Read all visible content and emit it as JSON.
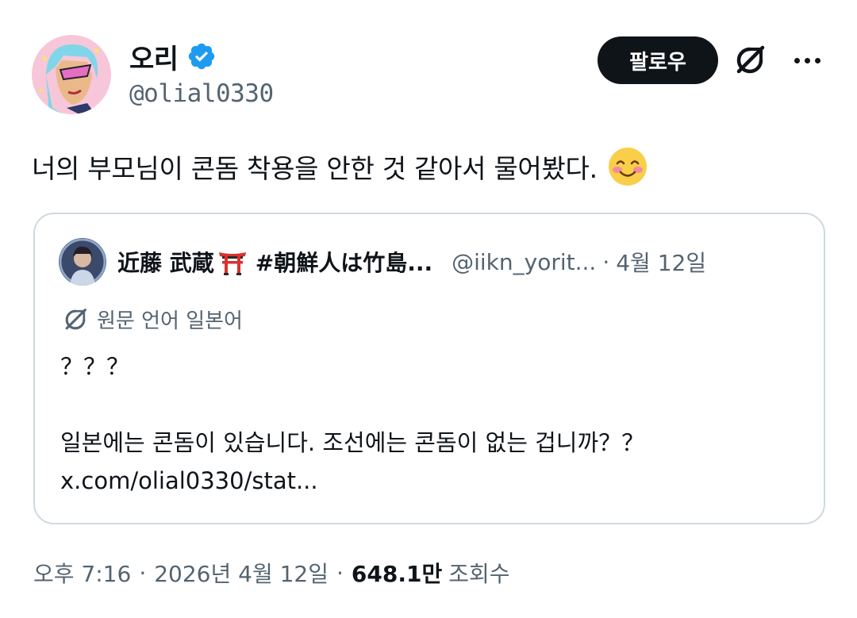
{
  "author": {
    "display_name": "오리",
    "handle": "@olial0330",
    "verified": true
  },
  "actions": {
    "follow_label": "팔로우",
    "grok_icon": "grok-icon",
    "more_icon": "more-icon"
  },
  "tweet": {
    "text": "너의 부모님이 콘돔 착용을 안한 것 같아서 물어봤다.",
    "emoji": "smiling-face-emoji"
  },
  "quote": {
    "author_name": "近藤 武蔵",
    "author_emoji": "torii-gate-emoji",
    "author_tag": "#朝鮮人は竹島...",
    "handle": "@iikn_yorit...",
    "separator": "·",
    "date": "4월 12일",
    "translate_label": "원문 언어 일본어",
    "body": "？？？\n\n일본에는 콘돔이 있습니다. 조선에는 콘돔이 없는 겁니까？？\nx.com/olial0330/stat..."
  },
  "meta": {
    "time": "오후 7:16",
    "separator": "·",
    "date": "2026년 4월 12일",
    "views_count": "648.1만",
    "views_label": "조회수"
  },
  "colors": {
    "text_primary": "#0f1419",
    "text_secondary": "#536471",
    "verified_blue": "#1d9bf0",
    "border": "#cfd9de"
  }
}
